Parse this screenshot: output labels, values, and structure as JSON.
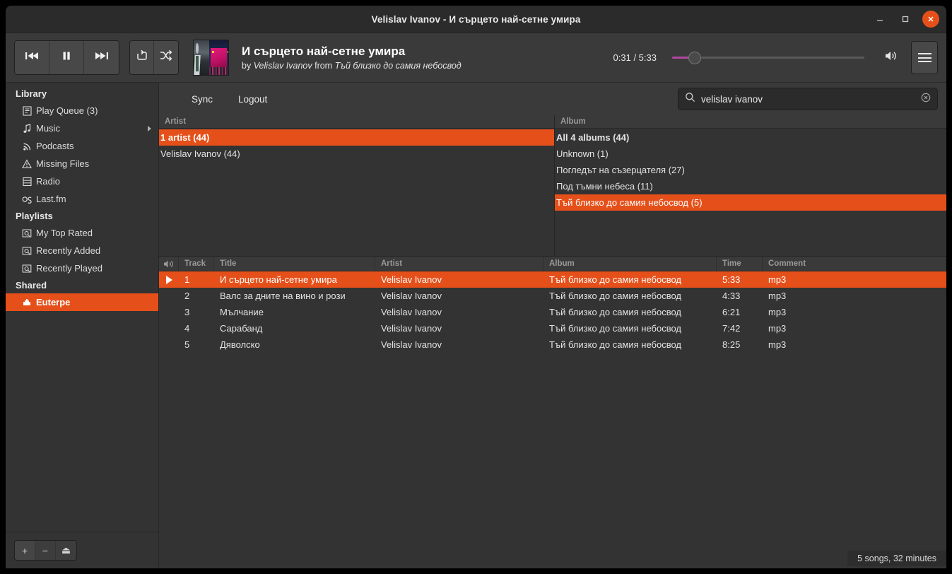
{
  "window": {
    "title": "Velislav Ivanov - И сърцето най-сетне умира",
    "minimize_label": "−",
    "maximize_label": "□",
    "close_label": "×"
  },
  "player": {
    "prev_label": "Previous",
    "pause_label": "Pause",
    "next_label": "Next",
    "repeat_label": "Repeat",
    "shuffle_label": "Shuffle",
    "now_playing_title": "И сърцето най-сетне умира",
    "by_label": "by",
    "artist": "Velislav Ivanov",
    "from_label": "from",
    "album": "Тъй близко до самия небосвод",
    "elapsed": "0:31",
    "duration": "5:33",
    "time_display": "0:31 / 5:33",
    "seek_percent": 9,
    "volume_label": "Volume",
    "menu_label": "Main menu"
  },
  "sidebar": {
    "sections": [
      {
        "header": "Library",
        "items": [
          {
            "label": "Play Queue (3)",
            "icon": "queue-icon",
            "selected": false,
            "expandable": false
          },
          {
            "label": "Music",
            "icon": "music-note-icon",
            "selected": false,
            "expandable": true
          },
          {
            "label": "Podcasts",
            "icon": "rss-icon",
            "selected": false,
            "expandable": false
          },
          {
            "label": "Missing Files",
            "icon": "warning-icon",
            "selected": false,
            "expandable": false
          },
          {
            "label": "Radio",
            "icon": "radio-icon",
            "selected": false,
            "expandable": false
          },
          {
            "label": "Last.fm",
            "icon": "lastfm-icon",
            "selected": false,
            "expandable": false
          }
        ]
      },
      {
        "header": "Playlists",
        "items": [
          {
            "label": "My Top Rated",
            "icon": "smart-playlist-icon",
            "selected": false,
            "expandable": false
          },
          {
            "label": "Recently Added",
            "icon": "smart-playlist-icon",
            "selected": false,
            "expandable": false
          },
          {
            "label": "Recently Played",
            "icon": "smart-playlist-icon",
            "selected": false,
            "expandable": false
          }
        ]
      },
      {
        "header": "Shared",
        "items": [
          {
            "label": "Euterpe",
            "icon": "share-icon",
            "selected": true,
            "expandable": false
          }
        ]
      }
    ],
    "footer": {
      "add_label": "+",
      "remove_label": "−",
      "eject_label": "⏏"
    }
  },
  "toolbar": {
    "sync_label": "Sync",
    "logout_label": "Logout"
  },
  "search": {
    "value": "velislav ivanov",
    "placeholder": "Search",
    "icon": "search-icon",
    "clear_icon": "clear-icon"
  },
  "artist_pane": {
    "header": "Artist",
    "rows": [
      {
        "label": "1 artist (44)",
        "selected": true,
        "bold": true
      },
      {
        "label": "Velislav Ivanov (44)",
        "selected": false,
        "bold": false
      }
    ]
  },
  "album_pane": {
    "header": "Album",
    "rows": [
      {
        "label": "All 4 albums (44)",
        "selected": false,
        "bold": true
      },
      {
        "label": "Unknown (1)",
        "selected": false,
        "bold": false
      },
      {
        "label": "Погледът на съзерцателя (27)",
        "selected": false,
        "bold": false
      },
      {
        "label": "Под тъмни небеса (11)",
        "selected": false,
        "bold": false
      },
      {
        "label": "Тъй близко до самия небосвод (5)",
        "selected": true,
        "bold": false
      }
    ]
  },
  "tracklist": {
    "columns": [
      "",
      "Track",
      "Title",
      "Artist",
      "Album",
      "Time",
      "Comment"
    ],
    "headers": {
      "icon": "",
      "track": "Track",
      "title": "Title",
      "artist": "Artist",
      "album": "Album",
      "time": "Time",
      "comment": "Comment"
    },
    "rows": [
      {
        "playing": true,
        "track": "1",
        "title": "И сърцето най-сетне умира",
        "artist": "Velislav Ivanov",
        "album": "Тъй близко до самия небосвод",
        "time": "5:33",
        "comment": "mp3"
      },
      {
        "playing": false,
        "track": "2",
        "title": "Валс за дните на вино и рози",
        "artist": "Velislav Ivanov",
        "album": "Тъй близко до самия небосвод",
        "time": "4:33",
        "comment": "mp3"
      },
      {
        "playing": false,
        "track": "3",
        "title": "Мълчание",
        "artist": "Velislav Ivanov",
        "album": "Тъй близко до самия небосвод",
        "time": "6:21",
        "comment": "mp3"
      },
      {
        "playing": false,
        "track": "4",
        "title": "Сарабанд",
        "artist": "Velislav Ivanov",
        "album": "Тъй близко до самия небосвод",
        "time": "7:42",
        "comment": "mp3"
      },
      {
        "playing": false,
        "track": "5",
        "title": "Дяволско",
        "artist": "Velislav Ivanov",
        "album": "Тъй близко до самия небосвод",
        "time": "8:25",
        "comment": "mp3"
      }
    ]
  },
  "statusbar": {
    "summary": "5 songs, 32 minutes"
  },
  "colors": {
    "accent": "#e5501a",
    "window_bg": "#333333",
    "toolbar_bg": "#3a3a3a",
    "titlebar_bg": "#2b2b2b",
    "seek_fill": "#b0489f",
    "text": "#e3e3e3",
    "muted_text": "#9a9a9a"
  }
}
